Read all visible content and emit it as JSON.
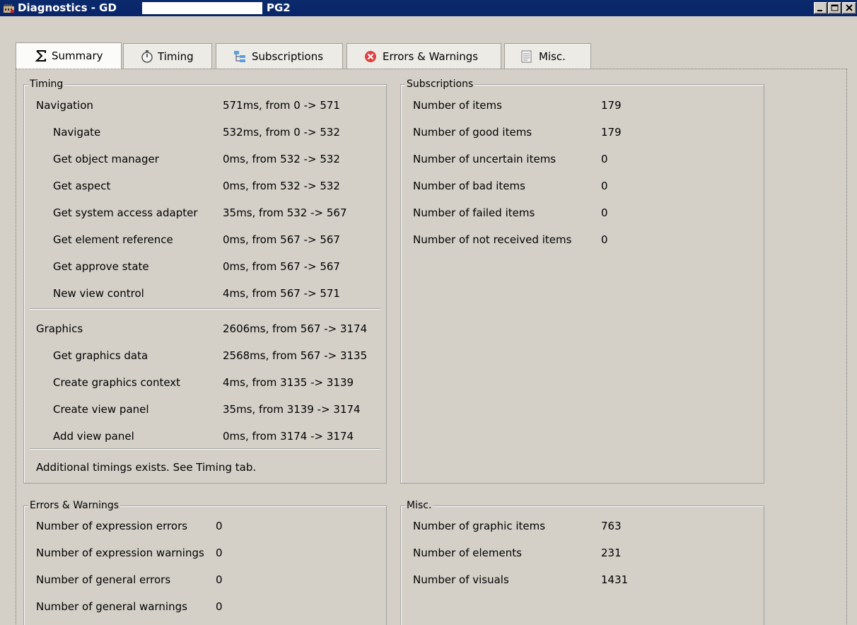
{
  "window": {
    "title_prefix": "Diagnostics - GD",
    "title_suffix": "PG2"
  },
  "tabs": [
    {
      "label": "Summary",
      "icon": "sigma-icon",
      "active": true
    },
    {
      "label": "Timing",
      "icon": "stopwatch-icon",
      "active": false
    },
    {
      "label": "Subscriptions",
      "icon": "tree-icon",
      "active": false
    },
    {
      "label": "Errors & Warnings",
      "icon": "error-icon",
      "active": false
    },
    {
      "label": "Misc.",
      "icon": "document-icon",
      "active": false
    }
  ],
  "timing": {
    "legend": "Timing",
    "navigation": {
      "label": "Navigation",
      "value": "571ms, from 0 -> 571"
    },
    "navigation_items": [
      {
        "label": "Navigate",
        "value": "532ms, from 0 -> 532"
      },
      {
        "label": "Get object manager",
        "value": "0ms, from 532 -> 532"
      },
      {
        "label": "Get aspect",
        "value": "0ms, from 532 -> 532"
      },
      {
        "label": "Get system access adapter",
        "value": "35ms, from 532 -> 567"
      },
      {
        "label": "Get element reference",
        "value": "0ms, from 567 -> 567"
      },
      {
        "label": "Get approve state",
        "value": "0ms, from 567 -> 567"
      },
      {
        "label": "New view control",
        "value": "4ms, from 567 -> 571"
      }
    ],
    "graphics": {
      "label": "Graphics",
      "value": "2606ms, from 567 -> 3174"
    },
    "graphics_items": [
      {
        "label": "Get graphics data",
        "value": "2568ms, from 567 -> 3135"
      },
      {
        "label": "Create graphics context",
        "value": "4ms, from 3135 -> 3139"
      },
      {
        "label": "Create view panel",
        "value": "35ms, from 3139 -> 3174"
      },
      {
        "label": "Add view panel",
        "value": "0ms, from 3174 -> 3174"
      }
    ],
    "footer": "Additional timings exists. See Timing tab."
  },
  "subscriptions": {
    "legend": "Subscriptions",
    "items": [
      {
        "label": "Number of items",
        "value": "179"
      },
      {
        "label": "Number of good items",
        "value": "179"
      },
      {
        "label": "Number of uncertain items",
        "value": "0"
      },
      {
        "label": "Number of bad items",
        "value": "0"
      },
      {
        "label": "Number of failed items",
        "value": "0"
      },
      {
        "label": "Number of not received items",
        "value": "0"
      }
    ]
  },
  "errors": {
    "legend": "Errors & Warnings",
    "items": [
      {
        "label": "Number of expression errors",
        "value": "0"
      },
      {
        "label": "Number of expression warnings",
        "value": "0"
      },
      {
        "label": "Number of general errors",
        "value": "0"
      },
      {
        "label": "Number of general warnings",
        "value": "0"
      }
    ]
  },
  "misc": {
    "legend": "Misc.",
    "items": [
      {
        "label": "Number of graphic items",
        "value": "763"
      },
      {
        "label": "Number of elements",
        "value": "231"
      },
      {
        "label": "Number of visuals",
        "value": "1431"
      }
    ]
  }
}
